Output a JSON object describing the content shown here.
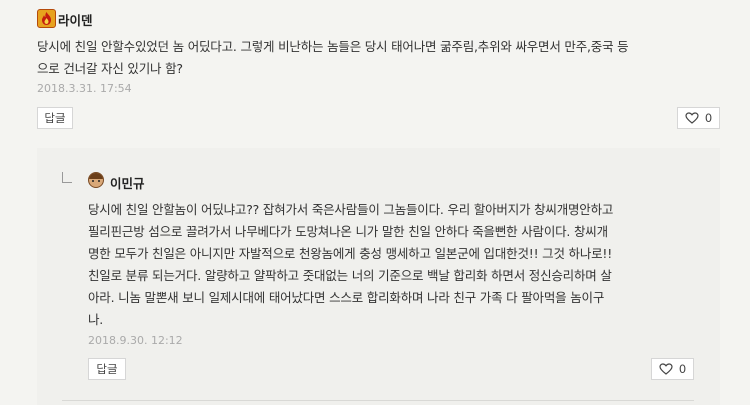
{
  "comment": {
    "author": "라이덴",
    "badge_icon": "fire-badge-icon",
    "lines": [
      "당시에 친일 안할수있었던 놈 어딨다고. 그렇게 비난하는 놈들은 당시 태어나면 굶주림,추위와 싸우면서 만주,중국 등",
      "으로 건너갈 자신 있기나 함?"
    ],
    "date": "2018.3.31. 17:54",
    "reply_label": "답글",
    "like_count": "0"
  },
  "reply": {
    "author": "이민규",
    "avatar_icon": "avatar-icon",
    "lines": [
      "당시에 친일 안할놈이 어딨냐고?? 잡혀가서 죽은사람들이 그놈들이다. 우리 할아버지가 창씨개명안하고",
      "필리핀근방 섬으로 끌려가서 나무베다가 도망쳐나온 니가 말한 친일 안하다 죽을뻔한 사람이다. 창씨개",
      "명한 모두가 친일은 아니지만 자발적으로 천왕놈에게 충성 맹세하고 일본군에 입대한것!! 그것 하나로!!",
      "친일로 분류 되는거다. 알량하고 얄팍하고 줏대없는 너의 기준으로 백날 합리화 하면서 정신승리하며 살",
      "아라. 니놈 말뽄새 보니 일제시대에 태어났다면 스스로 합리화하며 나라 친구 가족 다 팔아먹을 놈이구",
      "나."
    ],
    "date": "2018.9.30. 12:12",
    "reply_label": "답글",
    "like_count": "0"
  }
}
